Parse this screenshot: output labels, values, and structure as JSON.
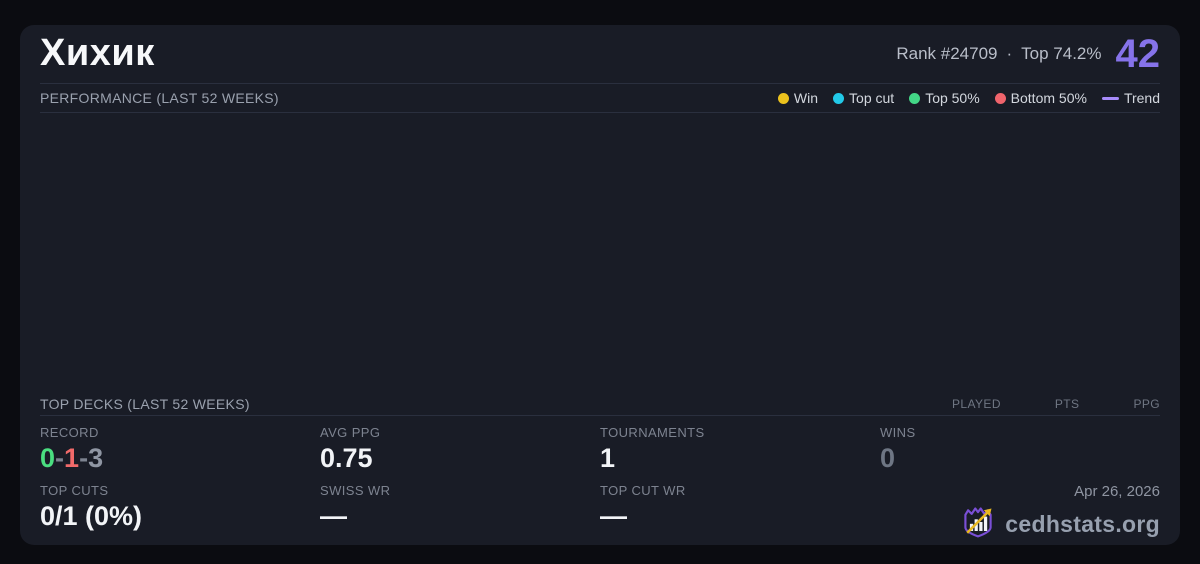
{
  "card": {
    "title": "Хихик",
    "rank_text": "Rank #24709",
    "separator": "·",
    "top_percent_text": "Top 74.2%",
    "score": "42",
    "score_color": "#8673ea"
  },
  "performance": {
    "heading": "PERFORMANCE (LAST 52 WEEKS)",
    "legend": [
      {
        "label": "Win",
        "color": "#ecc21d"
      },
      {
        "label": "Top cut",
        "color": "#22c9e8"
      },
      {
        "label": "Top 50%",
        "color": "#43d787"
      },
      {
        "label": "Bottom 50%",
        "color": "#f0646c"
      },
      {
        "label": "Trend",
        "color": "#a78bfa"
      }
    ]
  },
  "top_decks": {
    "heading": "TOP DECKS (LAST 52 WEEKS)",
    "columns": [
      "PLAYED",
      "PTS",
      "PPG"
    ],
    "rows": []
  },
  "stats": {
    "record": {
      "label": "RECORD",
      "wins": "0",
      "losses": "1",
      "draws": "3",
      "sep": "-"
    },
    "avg_ppg": {
      "label": "AVG PPG",
      "value": "0.75"
    },
    "tournaments": {
      "label": "TOURNAMENTS",
      "value": "1"
    },
    "wins": {
      "label": "WINS",
      "value": "0"
    },
    "top_cuts": {
      "label": "TOP CUTS",
      "value": "0/1 (0%)"
    },
    "swiss_wr": {
      "label": "SWISS WR",
      "value": "—"
    },
    "top_cut_wr": {
      "label": "TOP CUT WR",
      "value": "—"
    }
  },
  "footer": {
    "date": "Apr 26, 2026",
    "brand": "cedhstats.org",
    "logo_purple": "#7a4fd6",
    "logo_gold": "#e8b820"
  }
}
